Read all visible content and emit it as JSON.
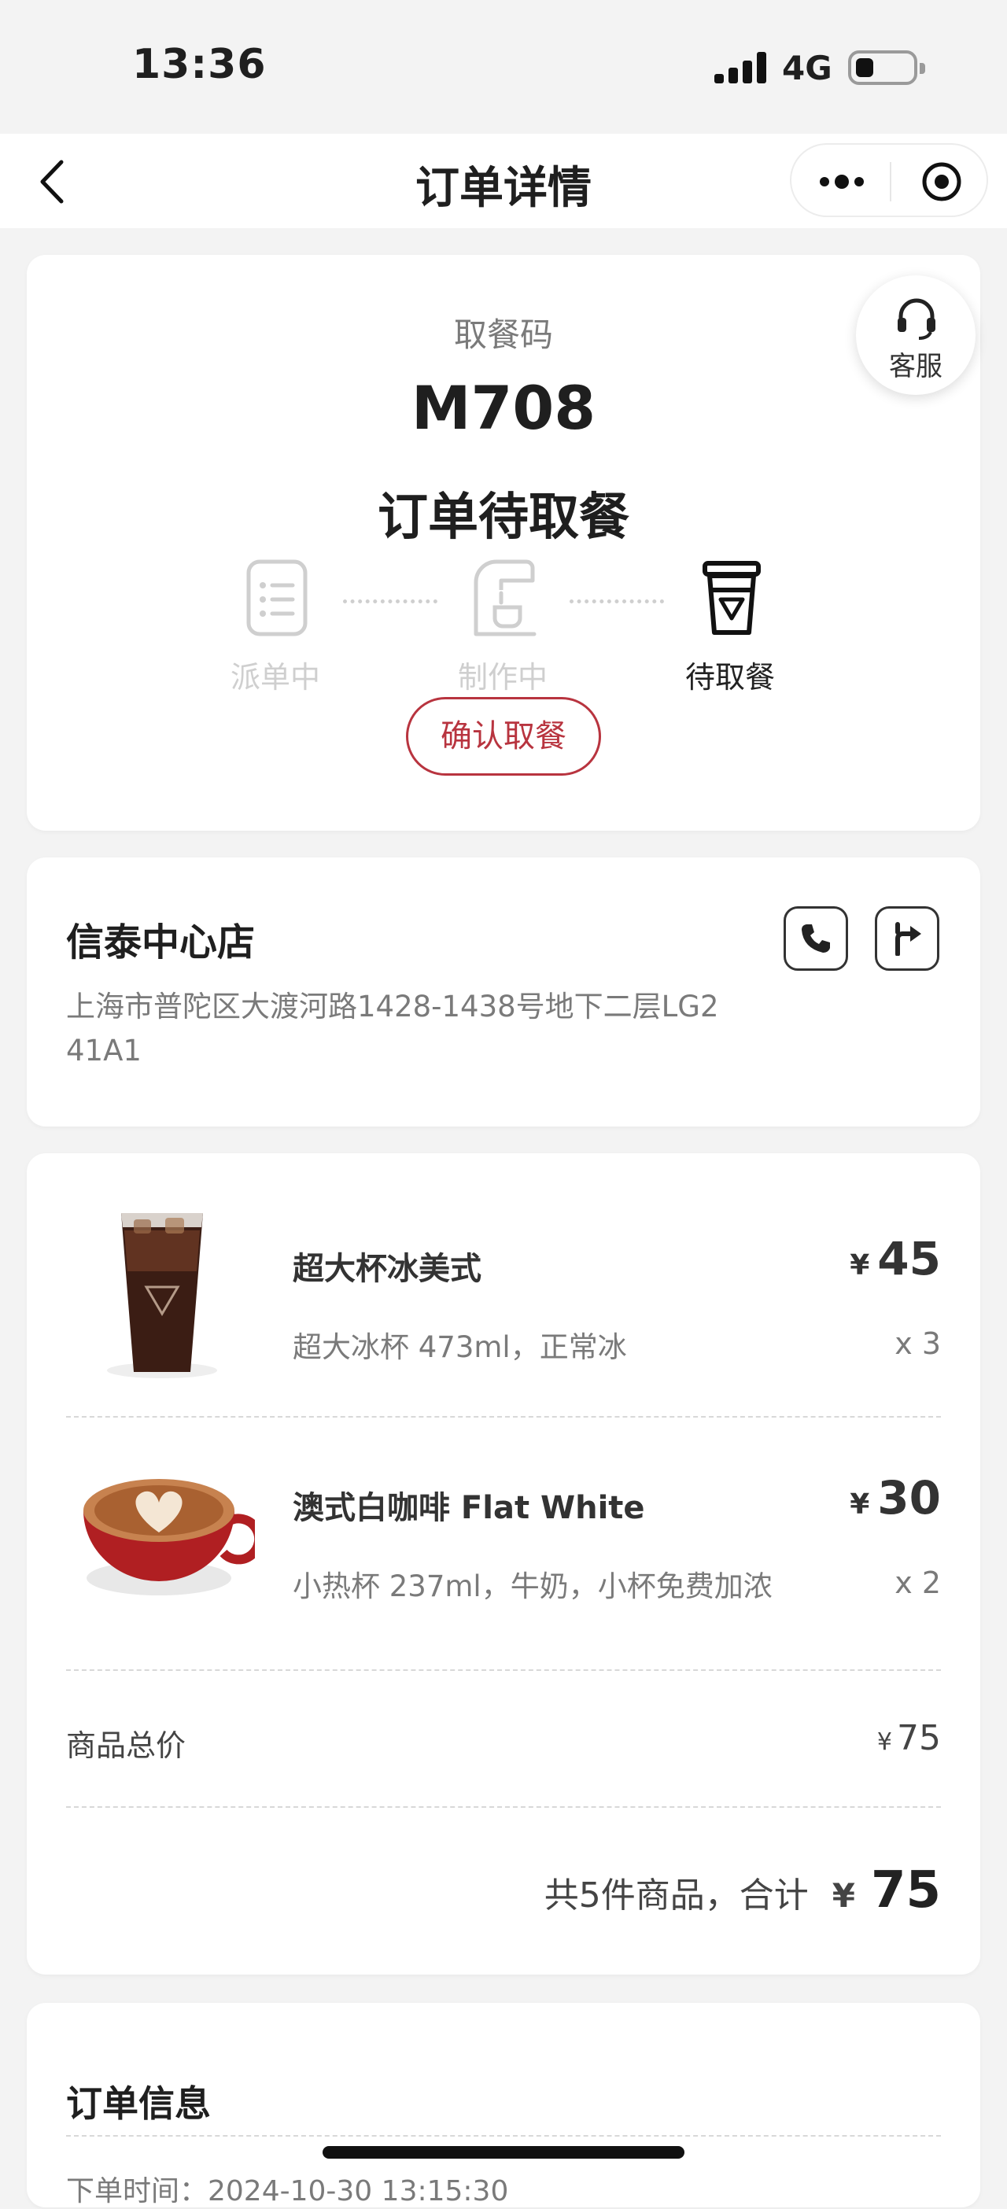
{
  "status_bar": {
    "time": "13:36",
    "network": "4G"
  },
  "nav": {
    "title": "订单详情",
    "more_icon": "more-dots-icon",
    "target_icon": "capsule-close-icon"
  },
  "order_status": {
    "pickup_label": "取餐码",
    "pickup_code": "M708",
    "status_title": "订单待取餐",
    "customer_service_label": "客服",
    "steps": [
      {
        "label": "派单中",
        "icon": "order-list-icon",
        "active": false
      },
      {
        "label": "制作中",
        "icon": "coffee-machine-icon",
        "active": false
      },
      {
        "label": "待取餐",
        "icon": "cup-icon",
        "active": true
      }
    ],
    "confirm_button": "确认取餐",
    "accent_color": "#b8343f"
  },
  "store": {
    "name": "信泰中心店",
    "address": "上海市普陀区大渡河路1428-1438号地下二层LG2 41A1"
  },
  "items": [
    {
      "name": "超大杯冰美式",
      "spec": "超大冰杯 473ml，正常冰",
      "currency": "¥",
      "price": "45",
      "qty": "x 3",
      "image": "iced-americano-image"
    },
    {
      "name": "澳式白咖啡 Flat White",
      "spec": "小热杯 237ml，牛奶，小杯免费加浓",
      "currency": "¥",
      "price": "30",
      "qty": "x 2",
      "image": "flat-white-image"
    }
  ],
  "summary": {
    "subtotal_label": "商品总价",
    "subtotal_currency": "¥",
    "subtotal_value": "75",
    "total_text": "共5件商品，合计",
    "total_currency": "¥",
    "total_value": "75"
  },
  "order_info": {
    "title": "订单信息",
    "partial_row": "下单时间：2024-10-30 13:15:30"
  }
}
